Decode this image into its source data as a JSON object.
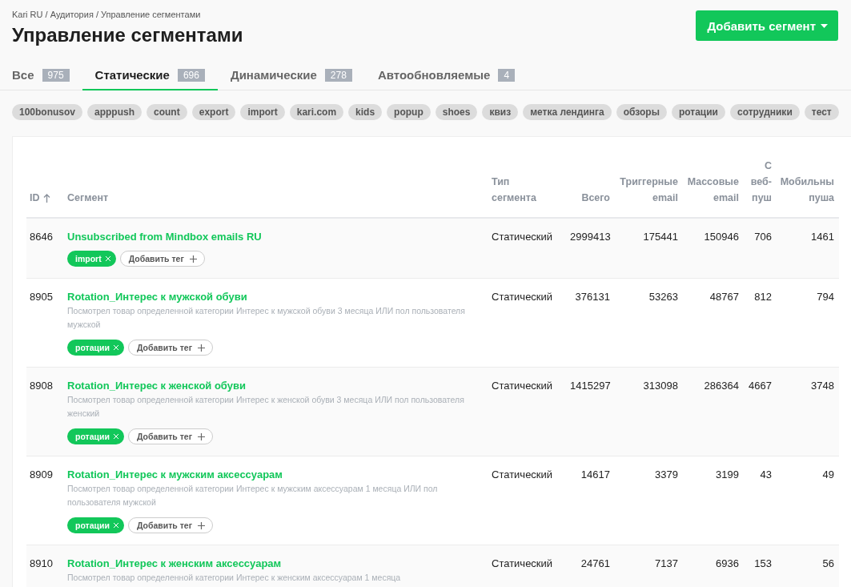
{
  "breadcrumb": "Kari RU / Аудитория / Управление сегментами",
  "title": "Управление сегментами",
  "add_button": {
    "label": "Добавить сегмент"
  },
  "tabs": [
    {
      "label": "Все",
      "count": "975",
      "selected": false
    },
    {
      "label": "Статические",
      "count": "696",
      "selected": true
    },
    {
      "label": "Динамические",
      "count": "278",
      "selected": false
    },
    {
      "label": "Автообновляемые",
      "count": "4",
      "selected": false
    }
  ],
  "tag_filters": [
    "100bonusov",
    "apppush",
    "count",
    "export",
    "import",
    "kari.com",
    "kids",
    "popup",
    "shoes",
    "квиз",
    "метка лендинга",
    "обзоры",
    "ротации",
    "сотрудники",
    "тест"
  ],
  "table": {
    "columns": [
      {
        "label": "ID",
        "kind": "text",
        "sorted": true
      },
      {
        "label": "Сегмент",
        "kind": "text"
      },
      {
        "label": "Тип\nсегмента",
        "kind": "text"
      },
      {
        "label": "Всего",
        "kind": "number"
      },
      {
        "label": "Триггерные\nemail",
        "kind": "number"
      },
      {
        "label": "Массовые\nemail",
        "kind": "number"
      },
      {
        "label": "С\nвеб-\nпуш",
        "kind": "number"
      },
      {
        "label": "Мобильны\nпуша",
        "kind": "number"
      }
    ],
    "rows": [
      {
        "id": "8646",
        "name": "Unsubscribed from Mindbox emails RU",
        "tags": [
          "import"
        ],
        "add_tag": "Добавить тег",
        "type": "Статический",
        "total": "2999413",
        "triggered": "175441",
        "mass": "150946",
        "web": "706",
        "mobile": "1461"
      },
      {
        "id": "8905",
        "name": "Rotation_Интерес к мужской обуви",
        "description": "Посмотрел товар определенной категории Интерес к мужской обуви 3 месяца ИЛИ пол пользователя мужской",
        "tags": [
          "ротации"
        ],
        "add_tag": "Добавить тег",
        "type": "Статический",
        "total": "376131",
        "triggered": "53263",
        "mass": "48767",
        "web": "812",
        "mobile": "794"
      },
      {
        "id": "8908",
        "name": "Rotation_Интерес к женской обуви",
        "description": "Посмотрел товар определенной категории Интерес к женской обуви 3 месяца ИЛИ пол пользователя женский",
        "tags": [
          "ротации"
        ],
        "add_tag": "Добавить тег",
        "type": "Статический",
        "total": "1415297",
        "triggered": "313098",
        "mass": "286364",
        "web": "4667",
        "mobile": "3748"
      },
      {
        "id": "8909",
        "name": "Rotation_Интерес к мужским аксессуарам",
        "description": "Посмотрел товар определенной категории Интерес к мужским аксессуарам 1 месяца ИЛИ пол пользователя мужской",
        "tags": [
          "ротации"
        ],
        "add_tag": "Добавить тег",
        "type": "Статический",
        "total": "14617",
        "triggered": "3379",
        "mass": "3199",
        "web": "43",
        "mobile": "49"
      },
      {
        "id": "8910",
        "name": "Rotation_Интерес к женским аксессуарам",
        "description": "Посмотрел товар определенной категории Интерес к женским аксессуарам 1 месяца",
        "type": "Статический",
        "total": "24761",
        "triggered": "7137",
        "mass": "6936",
        "web": "153",
        "mobile": "56"
      }
    ]
  }
}
